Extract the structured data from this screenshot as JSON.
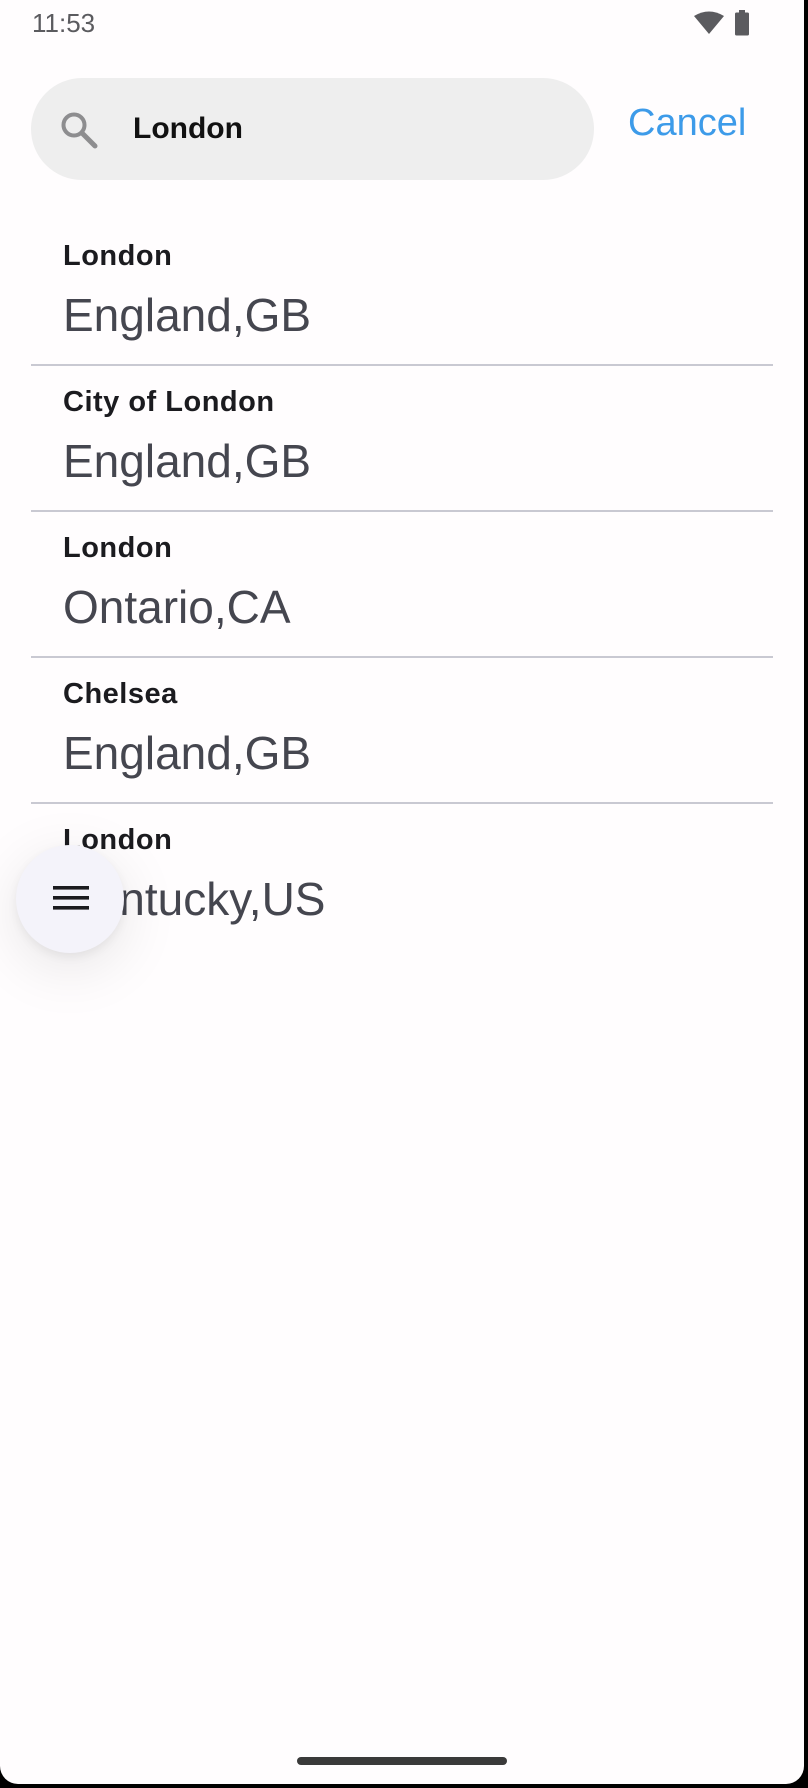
{
  "status_bar": {
    "time": "11:53",
    "icons": [
      "wifi-icon",
      "battery-icon"
    ]
  },
  "search": {
    "icon": "search-icon",
    "value": "London",
    "cancel_label": "Cancel"
  },
  "results": [
    {
      "city": "London",
      "region": "England,GB"
    },
    {
      "city": "City of London",
      "region": "England,GB"
    },
    {
      "city": "London",
      "region": "Ontario,CA"
    },
    {
      "city": "Chelsea",
      "region": "England,GB"
    },
    {
      "city": "London",
      "region": "Kentucky,US"
    }
  ],
  "fab": {
    "icon": "menu-icon"
  },
  "colors": {
    "accent": "#3d9be9",
    "search_bg": "#eeeeee",
    "divider": "#c9c9d2",
    "fab_bg": "#f4f3fa"
  }
}
